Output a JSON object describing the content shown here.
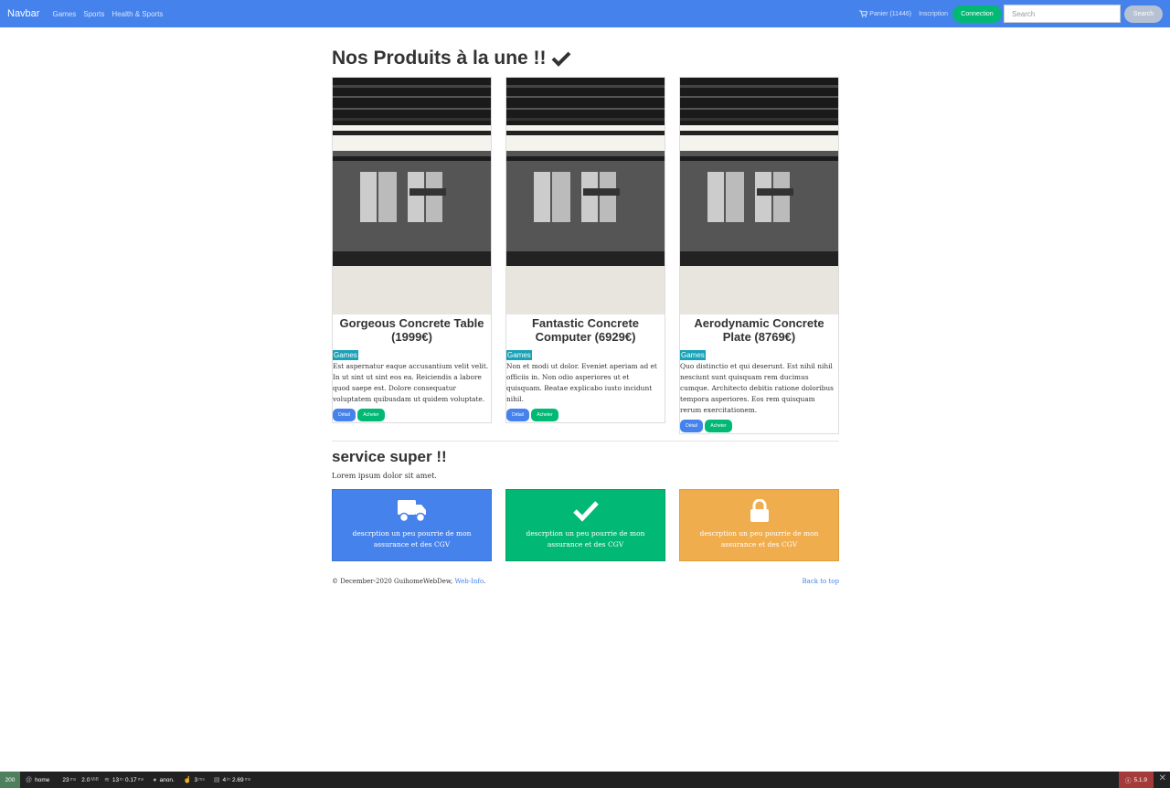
{
  "navbar": {
    "brand": "Navbar",
    "links": [
      "Games",
      "Sports",
      "Health & Sports"
    ],
    "cart_label": "Panier (11446)",
    "inscription": "Inscription",
    "connection": "Connection",
    "search_placeholder": "Search",
    "search_button": "Search"
  },
  "main": {
    "title": "Nos Produits à la une !!",
    "products": [
      {
        "title": "Gorgeous Concrete Table (1999€)",
        "category": "Games",
        "description": "Est aspernatur eaque accusantium velit velit. In ut sint ut sint eos ea. Reiciendis a labore quod saepe est. Dolore consequatur voluptatem quibusdam ut quidem voluptate.",
        "detail_label": "Détail",
        "buy_label": "Acheter"
      },
      {
        "title": "Fantastic Concrete Computer (6929€)",
        "category": "Games",
        "description": "Non et modi ut dolor. Eveniet aperiam ad et officiis in. Non odio asperiores ut et quisquam. Beatae explicabo iusto incidunt nihil.",
        "detail_label": "Détail",
        "buy_label": "Acheter"
      },
      {
        "title": "Aerodynamic Concrete Plate (8769€)",
        "category": "Games",
        "description": "Quo distinctio et qui deserunt. Est nihil nihil nesciunt sunt quisquam rem ducimus cumque. Architecto debitis ratione doloribus tempora asperiores. Eos rem quisquam rerum exercitationem.",
        "detail_label": "Détail",
        "buy_label": "Acheter"
      }
    ]
  },
  "services": {
    "title": "service super !!",
    "subtitle": "Lorem ipsum dolor sit amet.",
    "boxes": [
      {
        "icon": "truck-icon",
        "text": "descrption un peu pourrie de mon assurance et des CGV",
        "color": "#4582ec"
      },
      {
        "icon": "check-icon",
        "text": "descrption un peu pourrie de mon assurance et des CGV",
        "color": "#02b875"
      },
      {
        "icon": "lock-icon",
        "text": "descrption un peu pourrie de mon assurance et des CGV",
        "color": "#f0ad4e"
      }
    ]
  },
  "footer": {
    "copyright": "© December-2020 GuihomeWebDew,",
    "link": "Web-Info",
    "back_to_top": "Back to top"
  },
  "toolbar": {
    "status": "200",
    "route": "home",
    "time_value": "23",
    "time_unit": "ms",
    "memory_value": "2.0",
    "memory_unit": "MiB",
    "twig_value": "13",
    "twig_time": "0.17",
    "user": "anon.",
    "events_value": "3",
    "events_unit": "ms",
    "db_value": "4",
    "db_time": "2.69",
    "version": "5.1.9"
  }
}
